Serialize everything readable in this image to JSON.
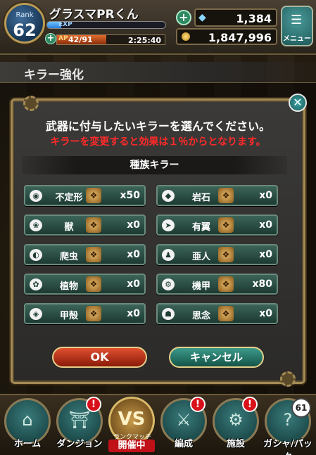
{
  "header": {
    "rank_label": "Rank",
    "rank_value": "62",
    "player_name": "グラスマPRくん",
    "exp_label": "EXP",
    "ap_label": "AP",
    "ap_value": "42/91",
    "ap_timer": "2:25:40",
    "gem_count": "1,384",
    "gold_count": "1,847,996",
    "menu_label": "メニュー"
  },
  "section": {
    "title": "キラー強化"
  },
  "dialog": {
    "message": "武器に付与したいキラーを選んでください。",
    "warning": "キラーを変更すると効果は１％からとなります。",
    "tribe_header": "種族キラー",
    "killers": [
      {
        "name": "不定形",
        "icon": "blob-icon",
        "glyph": "◉",
        "count": "x50"
      },
      {
        "name": "岩石",
        "icon": "rock-icon",
        "glyph": "◆",
        "count": "x0"
      },
      {
        "name": "獣",
        "icon": "paw-icon",
        "glyph": "❀",
        "count": "x0"
      },
      {
        "name": "有翼",
        "icon": "wing-icon",
        "glyph": "➤",
        "count": "x0"
      },
      {
        "name": "爬虫",
        "icon": "reptile-icon",
        "glyph": "◐",
        "count": "x0"
      },
      {
        "name": "亜人",
        "icon": "demihuman-icon",
        "glyph": "♟",
        "count": "x0"
      },
      {
        "name": "植物",
        "icon": "plant-icon",
        "glyph": "✿",
        "count": "x0"
      },
      {
        "name": "機甲",
        "icon": "gear-icon",
        "glyph": "⚙",
        "count": "x80"
      },
      {
        "name": "甲殻",
        "icon": "shell-icon",
        "glyph": "◈",
        "count": "x0"
      },
      {
        "name": "思念",
        "icon": "spirit-icon",
        "glyph": "☗",
        "count": "x0"
      }
    ],
    "ok_label": "OK",
    "cancel_label": "キャンセル"
  },
  "nav": {
    "home": "ホーム",
    "dungeon": "ダンジョン",
    "vs_glyph": "VS",
    "ranked_label": "ランクマッチ",
    "ranked_status": "開催中",
    "formation": "編成",
    "facility": "施設",
    "gacha": "ガシャ/パック",
    "gacha_badge": "61",
    "alert_glyph": "!"
  },
  "colors": {
    "warning": "#ff2a2a",
    "accent_teal": "#1c3a32",
    "frame_gold": "#a48a55"
  }
}
